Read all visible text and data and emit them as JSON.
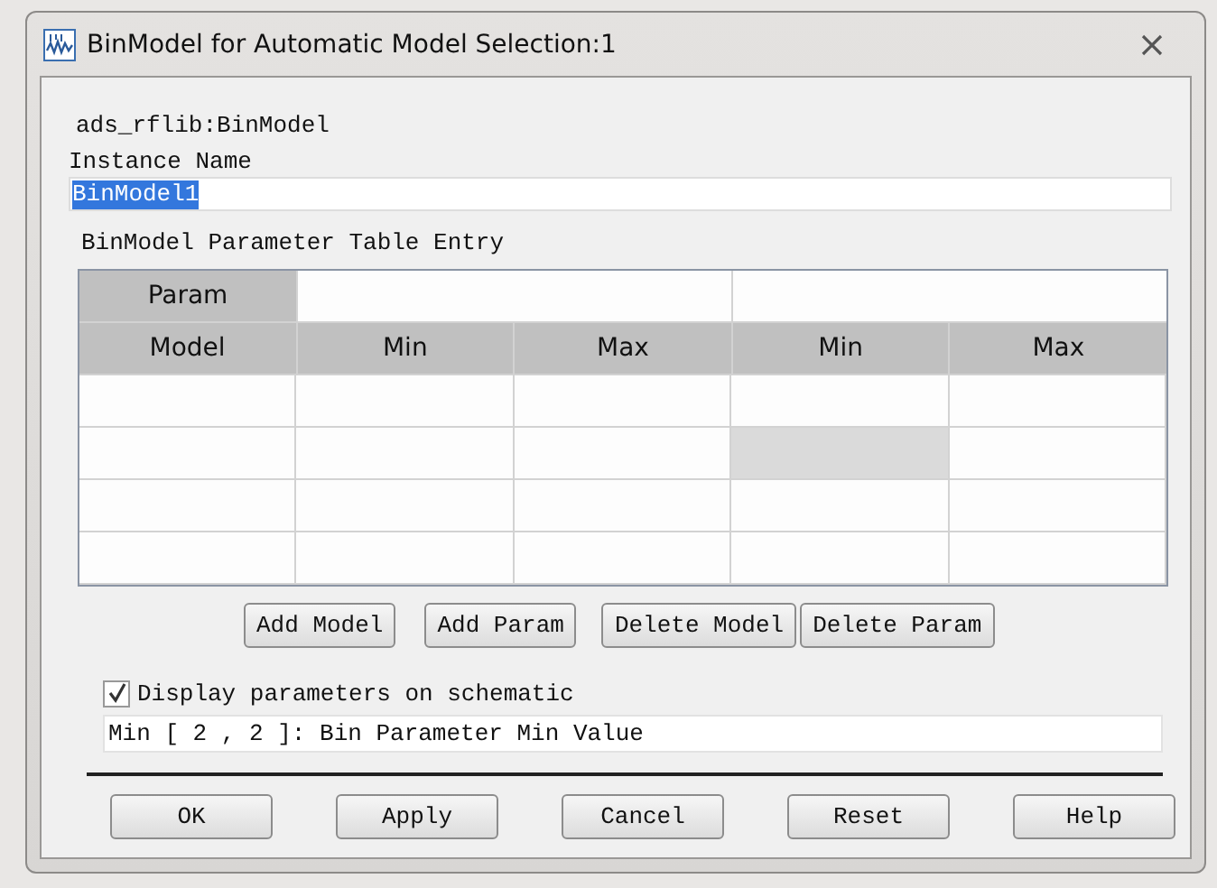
{
  "window": {
    "title": "BinModel for Automatic Model Selection:1"
  },
  "component_name": "ads_rflib:BinModel",
  "instance": {
    "label": "Instance Name",
    "value": "BinModel1",
    "selected": true
  },
  "table": {
    "title": "BinModel Parameter Table Entry",
    "param_header": "Param",
    "model_header": "Model",
    "param_groups": [
      {
        "columns": [
          "Min",
          "Max"
        ]
      },
      {
        "columns": [
          "Min",
          "Max"
        ]
      }
    ],
    "rows": [
      {
        "cells": [
          {
            "selected": false
          },
          {
            "selected": false
          },
          {
            "selected": false
          },
          {
            "selected": false
          },
          {
            "selected": false
          }
        ]
      },
      {
        "cells": [
          {
            "selected": false
          },
          {
            "selected": false
          },
          {
            "selected": false
          },
          {
            "selected": true
          },
          {
            "selected": false
          }
        ]
      },
      {
        "cells": [
          {
            "selected": false
          },
          {
            "selected": false
          },
          {
            "selected": false
          },
          {
            "selected": false
          },
          {
            "selected": false
          }
        ]
      },
      {
        "cells": [
          {
            "selected": false
          },
          {
            "selected": false
          },
          {
            "selected": false
          },
          {
            "selected": false
          },
          {
            "selected": false
          }
        ]
      }
    ]
  },
  "table_buttons": [
    "Add Model",
    "Add Param",
    "Delete Model",
    "Delete Param"
  ],
  "display_option": {
    "label": "Display parameters on schematic",
    "checked": true
  },
  "status": "Min [ 2 , 2 ]:  Bin Parameter Min Value",
  "footer_buttons": [
    "OK",
    "Apply",
    "Cancel",
    "Reset",
    "Help"
  ]
}
